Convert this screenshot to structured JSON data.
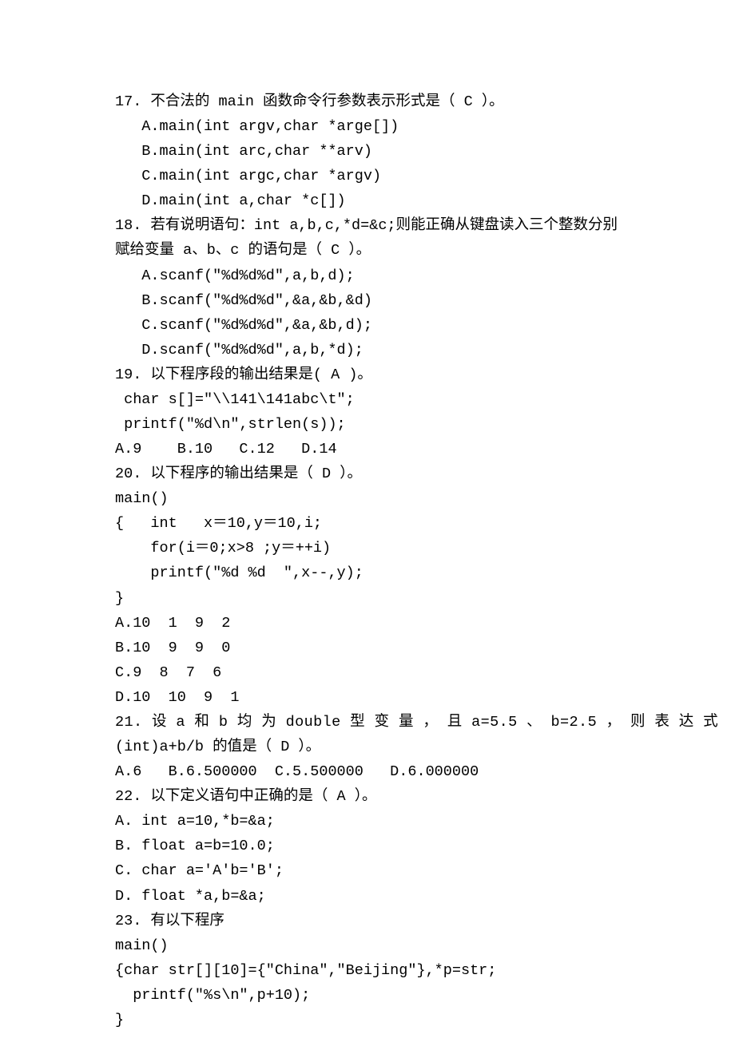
{
  "q17": {
    "stem": "17. 不合法的 main 函数命令行参数表示形式是（ C ）。",
    "a": "A.main(int argv,char *arge[])",
    "b": "B.main(int arc,char **arv)",
    "c": "C.main(int argc,char *argv)",
    "d": "D.main(int a,char *c[])"
  },
  "q18": {
    "stem1": "18. 若有说明语句：int a,b,c,*d=&c;则能正确从键盘读入三个整数分别",
    "stem2": "赋给变量 a、b、c 的语句是（ C ）。",
    "a": "A.scanf(\"%d%d%d\",a,b,d);",
    "b": "B.scanf(\"%d%d%d\",&a,&b,&d)",
    "c": "C.scanf(\"%d%d%d\",&a,&b,d);",
    "d": "D.scanf(\"%d%d%d\",a,b,*d);"
  },
  "q19": {
    "stem": "19. 以下程序段的输出结果是( A )。",
    "code1": " char s[]=\"\\\\141\\141abc\\t\";",
    "code2": " printf(\"%d\\n\",strlen(s));",
    "opts": "A.9    B.10   C.12   D.14"
  },
  "q20": {
    "stem": "20. 以下程序的输出结果是（ D ）。",
    "code1": "main()",
    "code2": "{   int   x＝10,y＝10,i;",
    "code3": "    for(i＝0;x>8 ;y＝++i)",
    "code4": "    printf(\"%d %d  \",x--,y);",
    "code5": "}",
    "a": "A.10  1  9  2",
    "b": "B.10  9  9  0",
    "c": "C.9  8  7  6",
    "d": "D.10  10  9  1"
  },
  "q21": {
    "stem1": "21. 设 a 和 b 均 为 double 型 变 量 ， 且 a=5.5 、 b=2.5 ， 则 表 达 式",
    "stem2": "(int)a+b/b 的值是（ D ）。",
    "opts": "A.6   B.6.500000  C.5.500000   D.6.000000"
  },
  "q22": {
    "stem": "22. 以下定义语句中正确的是（ A ）。",
    "a": "A. int a=10,*b=&a;",
    "b": "B. float a=b=10.0;",
    "c": "C. char a='A'b='B';",
    "d": "D. float *a,b=&a;"
  },
  "q23": {
    "stem": "23. 有以下程序",
    "code1": "main()",
    "code2": "{char str[][10]={\"China\",\"Beijing\"},*p=str;",
    "code3": "  printf(\"%s\\n\",p+10);",
    "code4": "}"
  }
}
